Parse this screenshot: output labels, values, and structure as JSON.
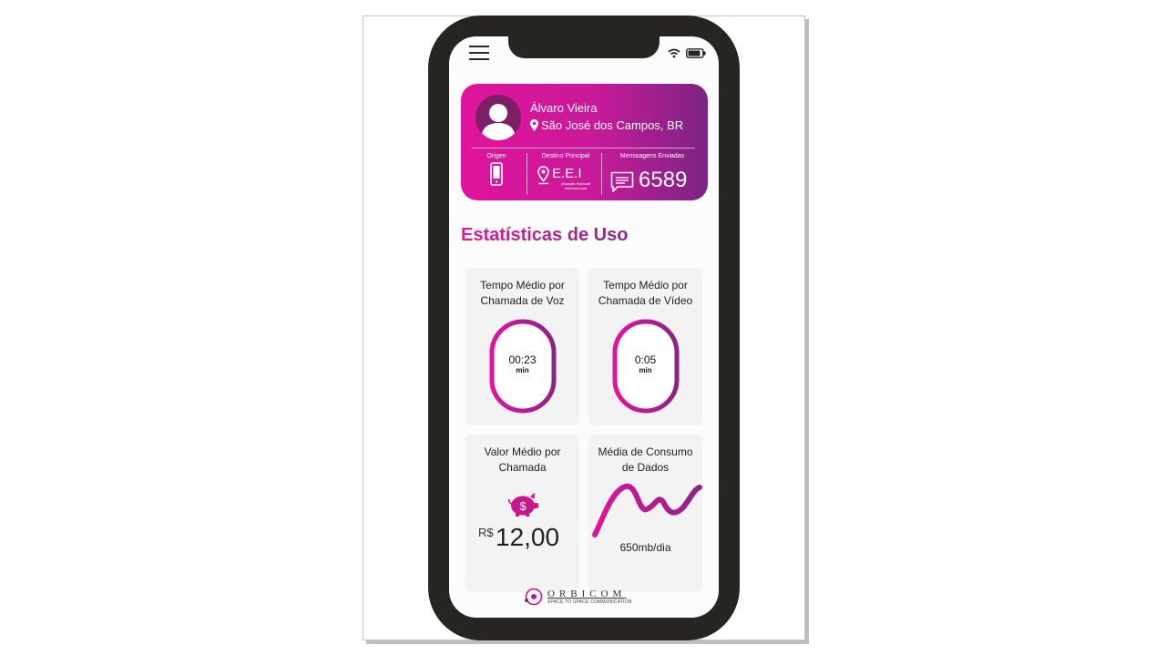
{
  "profile": {
    "name": "Álvaro Vieira",
    "location": "São José dos Campos, BR",
    "origin_label": "Origen",
    "destination_label": "Destino Principal",
    "destination_value": "E.E.I",
    "destination_sub": "(Estação Espacial Internacional)",
    "messages_label": "Menssagens Enviadas",
    "messages_count": "6589"
  },
  "stats": {
    "title": "Estatísticas de Uso",
    "voice": {
      "title_line1": "Tempo Médio por",
      "title_line2": "Chamada de Voz",
      "value": "00:23",
      "unit": "min"
    },
    "video": {
      "title_line1": "Tempo Médio por",
      "title_line2": "Chamada de Vídeo",
      "value": "0:05",
      "unit": "min"
    },
    "cost": {
      "title_line1": "Valor Médio por",
      "title_line2": "Chamada",
      "currency": "R$",
      "value": "12,00",
      "icon": "piggy-bank-icon"
    },
    "data": {
      "title_line1": "Média de Consumo",
      "title_line2": "de Dados",
      "value": "650mb/dia",
      "icon": "wave-chart-icon"
    }
  },
  "brand": {
    "name": "ORBICOM",
    "tagline": "SPACE TO SPACE COMMUNICATION"
  },
  "colors": {
    "magenta": "#e2139d",
    "purple": "#7c2484",
    "phone_frame": "#262521"
  }
}
